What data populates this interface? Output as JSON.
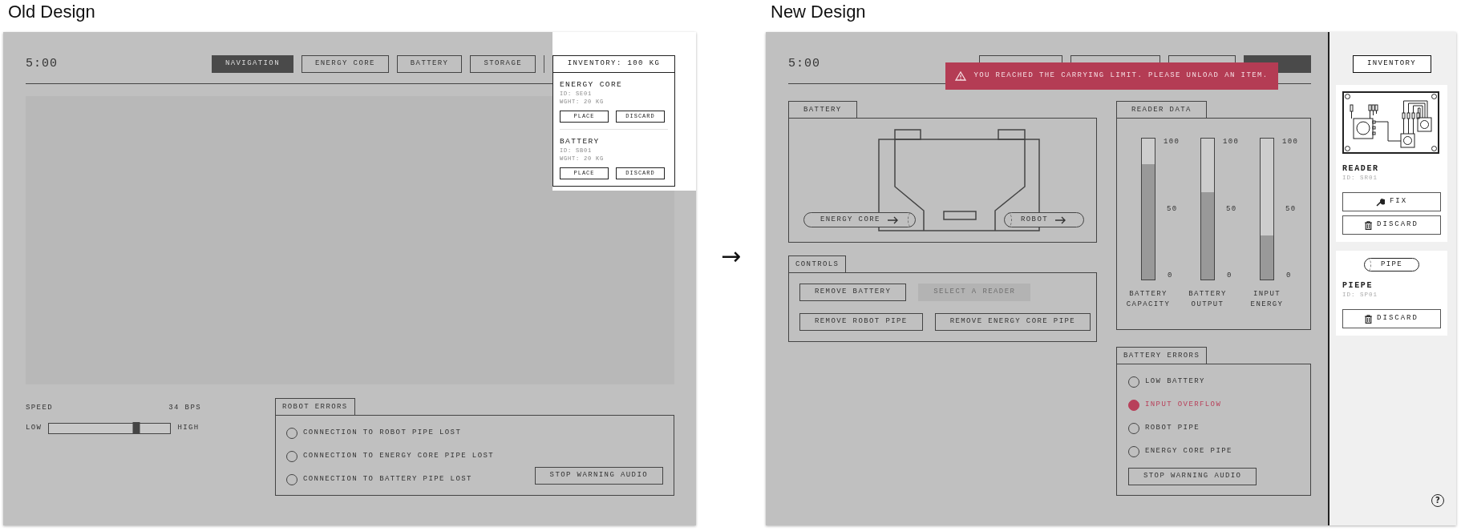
{
  "old_design": {
    "heading": "Old Design",
    "time": "5:00",
    "nav_tabs": [
      {
        "label": "NAVIGATION",
        "selected": true
      },
      {
        "label": "ENERGY CORE",
        "selected": false
      },
      {
        "label": "BATTERY",
        "selected": false
      },
      {
        "label": "STORAGE",
        "selected": false
      }
    ],
    "inventory": {
      "title": "INVENTORY: 100 KG",
      "items": [
        {
          "name": "ENERGY CORE",
          "id": "ID: SE01",
          "weight": "WGHT: 20 KG",
          "buttons": [
            "PLACE",
            "DISCARD"
          ]
        },
        {
          "name": "BATTERY",
          "id": "ID: SB01",
          "weight": "WGHT: 20 KG",
          "buttons": [
            "PLACE",
            "DISCARD"
          ]
        }
      ]
    },
    "speed": {
      "label": "SPEED",
      "reading": "34 BPS",
      "low": "LOW",
      "high": "HIGH",
      "level": 0.72
    },
    "robot_errors": {
      "title": "ROBOT ERRORS",
      "items": [
        {
          "label": "CONNECTION TO ROBOT PIPE LOST",
          "active": false
        },
        {
          "label": "CONNECTION TO ENERGY CORE PIPE LOST",
          "active": false
        },
        {
          "label": "CONNECTION TO BATTERY PIPE LOST",
          "active": false
        }
      ],
      "button": "STOP WARNING AUDIO"
    }
  },
  "arrow": "→",
  "new_design": {
    "heading": "New Design",
    "time": "5:00",
    "nav_tabs": [
      {
        "selected": false
      },
      {
        "selected": false
      },
      {
        "selected": false
      },
      {
        "selected": true
      }
    ],
    "toast": {
      "text": "YOU REACHED THE CARRYING LIMIT. PLEASE UNLOAD AN ITEM."
    },
    "battery": {
      "title": "BATTERY",
      "pipes": [
        {
          "label": "ENERGY CORE"
        },
        {
          "label": "ROBOT"
        }
      ]
    },
    "reader_data": {
      "title": "READER DATA",
      "meters": [
        {
          "label": "BATTERY CAPACITY",
          "level": 0.82,
          "ticks": [
            "100",
            "50",
            "0"
          ]
        },
        {
          "label": "BATTERY OUTPUT",
          "level": 0.62,
          "ticks": [
            "100",
            "50",
            "0"
          ]
        },
        {
          "label": "INPUT ENERGY",
          "level": 0.31,
          "ticks": [
            "100",
            "50",
            "0"
          ]
        }
      ]
    },
    "controls": {
      "title": "CONTROLS",
      "rows": [
        [
          {
            "label": "REMOVE BATTERY",
            "disabled": false
          },
          {
            "label": "SELECT A READER",
            "disabled": true
          }
        ],
        [
          {
            "label": "REMOVE ROBOT PIPE",
            "disabled": false
          },
          {
            "label": "REMOVE ENERGY CORE PIPE",
            "disabled": false
          }
        ]
      ]
    },
    "battery_errors": {
      "title": "BATTERY ERRORS",
      "items": [
        {
          "label": "LOW BATTERY",
          "active": false
        },
        {
          "label": "INPUT OVERFLOW",
          "active": true
        },
        {
          "label": "ROBOT PIPE",
          "active": false
        },
        {
          "label": "ENERGY CORE PIPE",
          "active": false
        }
      ],
      "button": "STOP WARNING AUDIO"
    },
    "inventory": {
      "title": "INVENTORY",
      "items": [
        {
          "kind": "reader",
          "name": "READER",
          "id": "ID: SR01",
          "buttons": [
            {
              "kind": "fix",
              "label": "FIX"
            },
            {
              "kind": "discard",
              "label": "DISCARD"
            }
          ]
        },
        {
          "kind": "pipe",
          "badge": "PIPE",
          "name": "PIEPE",
          "id": "ID: SP01",
          "buttons": [
            {
              "kind": "discard",
              "label": "DISCARD"
            }
          ]
        }
      ]
    },
    "help": "?"
  }
}
